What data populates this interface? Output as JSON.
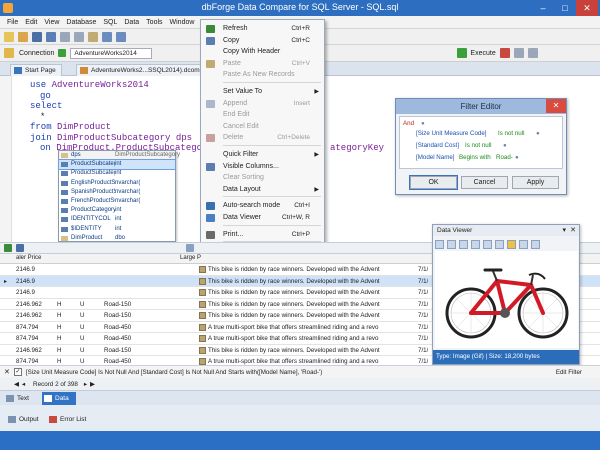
{
  "window": {
    "title": "dbForge Data Compare for SQL Server - SQL.sql"
  },
  "menubar": [
    "File",
    "Edit",
    "View",
    "Database",
    "SQL",
    "Data",
    "Tools",
    "Window"
  ],
  "toolbar": {
    "connection_label": "Connection",
    "connection_value": "AdventureWorks2014",
    "execute_label": "Execute"
  },
  "doc_tabs": {
    "start_page": "Start Page",
    "file_tab": "AdventureWorks2...SSQL2014).dcomp"
  },
  "code_lines": {
    "l1_kw": "use",
    "l1_id": " AdventureWorks2014",
    "l2": "go",
    "l3": "select",
    "l4": "*",
    "l5_kw": "from",
    "l5_id": " DimProduct",
    "l6_kw": "join",
    "l6_id": " DimProductSubcategory dps",
    "l7_kw": "on",
    "l7_id": " DimProduct.ProductSubcategor",
    "l7_tail": "ategoryKey"
  },
  "intellisense": {
    "header_alias": "dps",
    "header_table": "DimProductSubcategory",
    "items": [
      {
        "name": "ProductSubcatego...",
        "type": "int",
        "sel": true
      },
      {
        "name": "ProductSubcatego...",
        "type": "int"
      },
      {
        "name": "EnglishProductSub...",
        "type": "nvarchar("
      },
      {
        "name": "SpanishProductSu...",
        "type": "nvarchar("
      },
      {
        "name": "FrenchProductSub...",
        "type": "nvarchar("
      },
      {
        "name": "ProductCategoryKey",
        "type": "int"
      },
      {
        "name": "IDENTITYCOL",
        "type": "int"
      },
      {
        "name": "$IDENTITY",
        "type": "int"
      },
      {
        "name": "DimProduct",
        "type": "dbo",
        "group": true
      },
      {
        "name": "ProductKey",
        "type": "int"
      },
      {
        "name": "ProductAlternate...",
        "type": "nvarchar(25)"
      },
      {
        "name": "ProductSubcatego...",
        "type": "int"
      },
      {
        "name": "WeightUnitMeasu...",
        "type": "nchar(3)"
      },
      {
        "name": "SizeUnitMeasure...",
        "type": "nchar(3)"
      }
    ]
  },
  "context_menu": [
    {
      "label": "Refresh",
      "shortcut": "Ctrl+R",
      "ico": "#3a8a3a"
    },
    {
      "label": "Copy",
      "shortcut": "Ctrl+C",
      "ico": "#5a7db2"
    },
    {
      "label": "Copy With Header",
      "shortcut": ""
    },
    {
      "label": "Paste",
      "shortcut": "Ctrl+V",
      "dis": true,
      "ico": "#c2ab72"
    },
    {
      "label": "Paste As New Records",
      "shortcut": "",
      "dis": true
    },
    {
      "sep": true
    },
    {
      "label": "Set Value To",
      "shortcut": "",
      "arrow": true
    },
    {
      "label": "Append",
      "shortcut": "Insert",
      "dis": true,
      "ico": "#a9b8ca"
    },
    {
      "label": "End Edit",
      "shortcut": "",
      "dis": true
    },
    {
      "label": "Cancel Edit",
      "shortcut": "",
      "dis": true
    },
    {
      "label": "Delete",
      "shortcut": "Ctrl+Delete",
      "dis": true,
      "ico": "#c9a0a0"
    },
    {
      "sep": true
    },
    {
      "label": "Quick Filter",
      "shortcut": "",
      "arrow": true
    },
    {
      "label": "Visible Columns...",
      "shortcut": "",
      "ico": "#5a7db2"
    },
    {
      "label": "Clear Sorting",
      "shortcut": "",
      "dis": true
    },
    {
      "label": "Data Layout",
      "shortcut": "",
      "arrow": true
    },
    {
      "sep": true
    },
    {
      "label": "Auto-search mode",
      "shortcut": "Ctrl+I",
      "ico": "#3a6fb0"
    },
    {
      "label": "Data Viewer",
      "shortcut": "Ctrl+W, R",
      "ico": "#4a7fc4"
    },
    {
      "sep": true
    },
    {
      "label": "Print...",
      "shortcut": "Ctrl+P",
      "ico": "#6a6a6a"
    },
    {
      "sep": true
    },
    {
      "label": "Options...",
      "shortcut": "",
      "ico": "#7a8aa0"
    }
  ],
  "filter_editor": {
    "title": "Filter Editor",
    "and_label": "And",
    "c1_field": "[Size Unit Measure Code]",
    "c1_op": "Is not null",
    "c2_field": "[Standard Cost]",
    "c2_op": "Is not null",
    "c3_field": "[Model Name]",
    "c3_op": "Begins with",
    "c3_val": "Road-",
    "ok": "OK",
    "cancel": "Cancel",
    "apply": "Apply"
  },
  "data_viewer": {
    "title": "Data Viewer",
    "status": "Type: Image (Gif)  |  Size: 18,200 bytes"
  },
  "grid": {
    "hdr_price": "aler Price",
    "hdr_large": "Large P",
    "rows": [
      {
        "price": "2146.9",
        "c1": "",
        "c2": "",
        "model": "",
        "desc": "This bike is ridden by race winners. Developed with the Advent",
        "date": "7/1/"
      },
      {
        "price": "2146.9",
        "c1": "",
        "c2": "",
        "model": "",
        "desc": "This bike is ridden by race winners. Developed with the Advent",
        "date": "7/1/",
        "sel": true
      },
      {
        "price": "2146.9",
        "c1": "",
        "c2": "",
        "model": "",
        "desc": "This bike is ridden by race winners. Developed with the Advent",
        "date": "7/1/"
      },
      {
        "price": "2146.962",
        "c1": "H",
        "c2": "U",
        "model": "Road-150",
        "desc": "This bike is ridden by race winners. Developed with the Advent",
        "date": "7/1/"
      },
      {
        "price": "2146.962",
        "c1": "H",
        "c2": "U",
        "model": "Road-150",
        "desc": "This bike is ridden by race winners. Developed with the Advent",
        "date": "7/1/"
      },
      {
        "price": "874.794",
        "c1": "H",
        "c2": "U",
        "model": "Road-450",
        "desc": "A true multi-sport bike that offers streamlined riding and a revo",
        "date": "7/1/"
      },
      {
        "price": "874.794",
        "c1": "H",
        "c2": "U",
        "model": "Road-450",
        "desc": "A true multi-sport bike that offers streamlined riding and a revo",
        "date": "7/1/"
      },
      {
        "price": "2146.962",
        "c1": "H",
        "c2": "U",
        "model": "Road-150",
        "desc": "This bike is ridden by race winners. Developed with the Advent",
        "date": "7/1/"
      },
      {
        "price": "874.794",
        "c1": "H",
        "c2": "U",
        "model": "Road-450",
        "desc": "A true multi-sport bike that offers streamlined riding and a revo",
        "date": "7/1/"
      }
    ]
  },
  "filter_bar": {
    "text": "[Size Unit Measure Code] Is Not Null And [Standard Cost] Is Not Null And Starts with([Model Name], 'Road-')",
    "edit": "Edit Filter"
  },
  "nav": {
    "record": "Record 2 of 398"
  },
  "bottom_tabs": {
    "text": "Text",
    "data": "Data",
    "output": "Output",
    "errors": "Error List"
  }
}
